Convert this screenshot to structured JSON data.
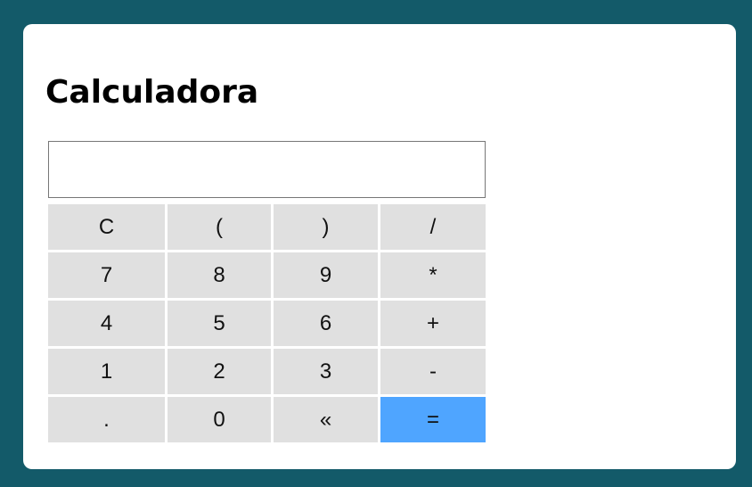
{
  "app": {
    "title": "Calculadora"
  },
  "display": {
    "value": ""
  },
  "keypad": {
    "rows": [
      [
        "C",
        "(",
        ")",
        "/"
      ],
      [
        "7",
        "8",
        "9",
        "*"
      ],
      [
        "4",
        "5",
        "6",
        "+"
      ],
      [
        "1",
        "2",
        "3",
        "-"
      ],
      [
        ".",
        "0",
        "«",
        "="
      ]
    ]
  },
  "colors": {
    "page_background": "#135a69",
    "card_background": "#ffffff",
    "key_background": "#e0e0e0",
    "equals_key_background": "#4fa5ff"
  }
}
